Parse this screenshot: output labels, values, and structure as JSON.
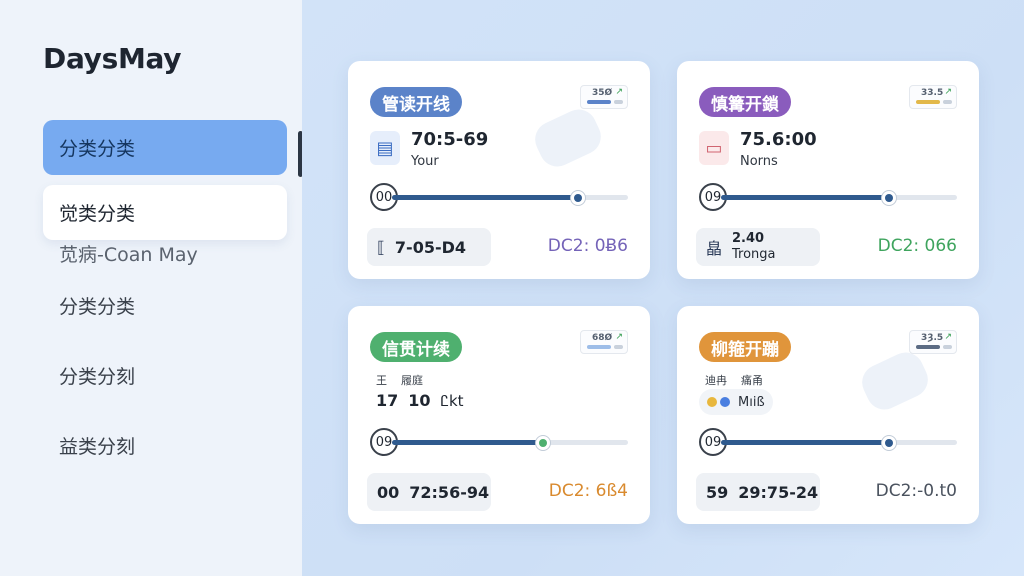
{
  "app": {
    "title": "DaysMay"
  },
  "sidebar": {
    "items": [
      {
        "label": "分类分类",
        "state": "active"
      },
      {
        "label": "觉类分类",
        "state": "hover"
      },
      {
        "label": "分类分类",
        "state": "normal"
      },
      {
        "label": "分类分刻",
        "state": "normal"
      },
      {
        "label": "益类分刻",
        "state": "normal"
      }
    ],
    "sub_label": "苋病-Coan May"
  },
  "colors": {
    "sidebar_active": "#77aaf0",
    "main_bg": "#cfe0f6",
    "blue": "#5b83c9",
    "purple": "#8a5cbd",
    "green": "#4fb06f",
    "orange": "#e0953b"
  },
  "cards": [
    {
      "pill": "管读开线",
      "mini": "35Ø",
      "time": "70:5-69",
      "sub": "Your",
      "icon": "document-icon",
      "start": "00",
      "progress": 0.79,
      "foot": "7-05-D4",
      "code": "DC2: 0Ƀ6"
    },
    {
      "pill": "慎篝开鎖",
      "mini": "33.5",
      "time": "75.6:00",
      "sub": "Norns",
      "icon": "card-icon",
      "start": "09",
      "progress": 0.71,
      "foot_a": "2.40",
      "foot_b": "Tronga",
      "foot_icon": "皛",
      "code": "DC2: 066"
    },
    {
      "pill": "信贯计续",
      "mini": "68Ø",
      "labels": [
        "王",
        "履庭"
      ],
      "stats": [
        "17",
        "10",
        "Ꮭkt"
      ],
      "start": "09",
      "progress": 0.64,
      "foot_a": "00",
      "foot_b": "72:56-94",
      "code": "DC2: 6ß4"
    },
    {
      "pill": "柳箍开蹦",
      "mini": "3Ȝ.5",
      "labels": [
        "迪冉",
        "痛甬"
      ],
      "chip": "Mıiß",
      "start": "09",
      "progress": 0.71,
      "foot_a": "59",
      "foot_b": "29:75-24",
      "code": "DC2:-0.t0"
    }
  ]
}
